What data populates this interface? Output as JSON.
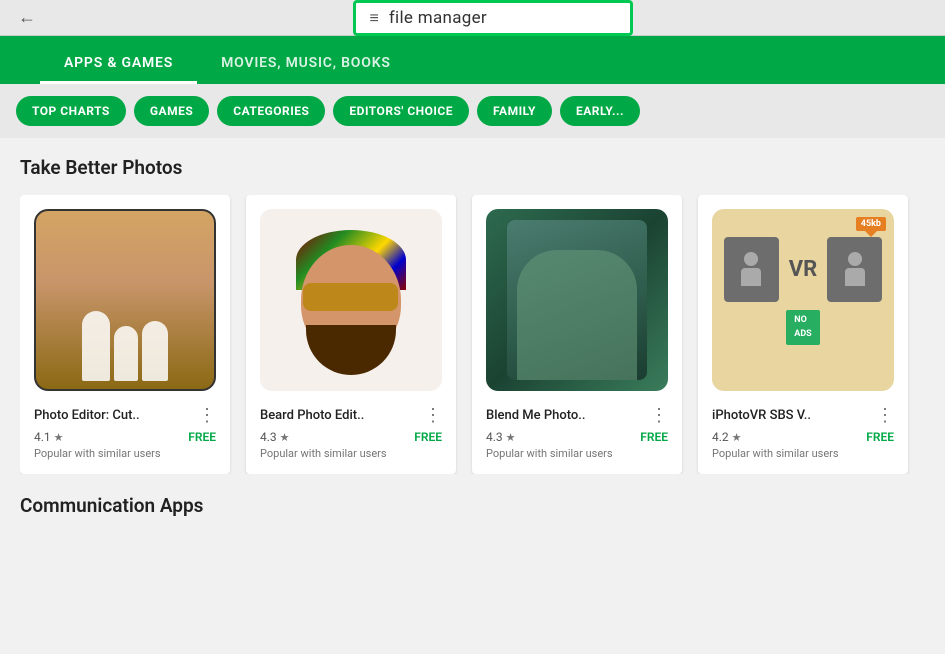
{
  "browser": {
    "back_label": "←"
  },
  "search": {
    "hamburger": "≡",
    "query": "file manager"
  },
  "nav": {
    "tabs": [
      {
        "id": "apps-games",
        "label": "APPS & GAMES",
        "active": true
      },
      {
        "id": "movies-music",
        "label": "MOVIES, MUSIC, BOOKS",
        "active": false
      }
    ]
  },
  "chips": [
    {
      "id": "top-charts",
      "label": "TOP CHARTS"
    },
    {
      "id": "games",
      "label": "GAMES"
    },
    {
      "id": "categories",
      "label": "CATEGORIES"
    },
    {
      "id": "editors-choice",
      "label": "EDITORS' CHOICE"
    },
    {
      "id": "family",
      "label": "FAMILY"
    },
    {
      "id": "early-access",
      "label": "EARLY..."
    }
  ],
  "sections": [
    {
      "id": "take-better-photos",
      "title": "Take Better Photos",
      "apps": [
        {
          "id": "photo-editor",
          "name": "Photo Editor: Cut..",
          "rating": "4.1",
          "price": "FREE",
          "popularity": "Popular with similar users",
          "thumb_type": "photo-editor"
        },
        {
          "id": "beard-photo",
          "name": "Beard Photo Edit..",
          "rating": "4.3",
          "price": "FREE",
          "popularity": "Popular with similar users",
          "thumb_type": "beard"
        },
        {
          "id": "blend-me",
          "name": "Blend Me Photo..",
          "rating": "4.3",
          "price": "FREE",
          "popularity": "Popular with similar users",
          "thumb_type": "blend"
        },
        {
          "id": "iphoto-vr",
          "name": "iPhotoVR SBS V..",
          "rating": "4.2",
          "price": "FREE",
          "popularity": "Popular with similar users",
          "thumb_type": "vr",
          "badge": "45kb"
        }
      ]
    }
  ],
  "communication_section": {
    "title": "Communication Apps"
  },
  "icons": {
    "more_vert": "⋮",
    "star": "★"
  }
}
